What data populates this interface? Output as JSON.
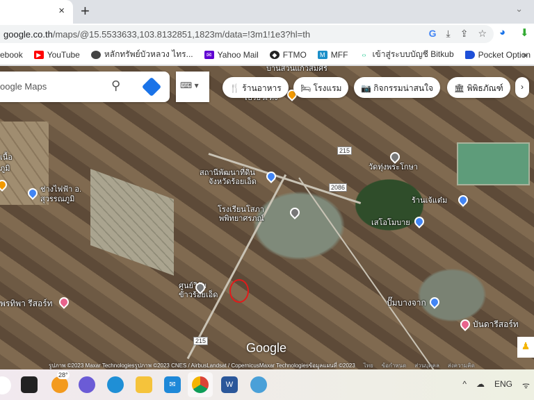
{
  "browser": {
    "tab_close": "×",
    "new_tab": "+",
    "tab_menu": "⌄",
    "url_host": "google.co.th",
    "url_path": "/maps/@15.5533633,103.8132851,1823m/data=!3m1!1e3?hl=th",
    "bookmarks": [
      {
        "label": "ebook",
        "icon": "facebook-icon"
      },
      {
        "label": "YouTube",
        "icon": "youtube-icon",
        "color": "#ff0000"
      },
      {
        "label": "หลักทรัพย์บัวหลวง ไทร...",
        "icon": "globe-icon"
      },
      {
        "label": "Yahoo Mail",
        "icon": "yahoo-mail-icon",
        "color": "#6001d2"
      },
      {
        "label": "FTMO",
        "icon": "ftmo-icon"
      },
      {
        "label": "MFF",
        "icon": "mff-icon"
      },
      {
        "label": "เข้าสู่ระบบบัญชี Bitkub",
        "icon": "bitkub-icon"
      },
      {
        "label": "Pocket Option",
        "icon": "pocket-option-icon"
      }
    ],
    "bookmarks_more": "»"
  },
  "maps": {
    "search_placeholder": "oogle Maps",
    "chips": [
      "ร้านอาหาร",
      "โรงแรม",
      "กิจกรรมน่าสนใจ",
      "พิพิธภัณฑ์"
    ],
    "chip_next": "›",
    "places": {
      "top": "บ้านสวนแก้วสมศรี",
      "top2": "เบรยวเฑิ่ง",
      "wat": "วัดทุ่งพระโกษา",
      "station1": "สถานีพัฒนาที่ดิน",
      "station2": "จังหวัดร้อยเอ็ด",
      "school1": "โรงเรียนโสภา",
      "school2": "พพิทยาศรภณ์",
      "shop": "ร้านเจ้แต๋ม",
      "mobile": "เสโอโมบาย",
      "rice1": "ศูนย์วิจัย",
      "rice2": "ข้าวร้อยเอ็ด",
      "elec1": "ช่างไฟฟ้า อ.",
      "elec2": "สุวรรณภูมิ",
      "left1": "เนื้อ",
      "left2": "ภูมิ",
      "resort": "พรทิพา รีสอร์ท",
      "pump": "ปั๊มบางจาก",
      "resort2": "บันดารีสอร์ท"
    },
    "roads": {
      "r215a": "215",
      "r2086": "2086",
      "r215b": "215"
    },
    "logo": "Google",
    "attribution": "รูปภาพ ©2023 Maxar Technologiesรูปภาพ ©2023 CNES / AirbusLandsat / CopernicusMaxar Technologiesข้อมูลแผนที่ ©2023",
    "footer_links": [
      "ไทย",
      "ข้อกำหนด",
      "ส่วนบุคคล",
      "ส่งความคิด"
    ]
  },
  "taskbar": {
    "weather": "28°",
    "lang": "ENG",
    "tray_up": "^"
  }
}
